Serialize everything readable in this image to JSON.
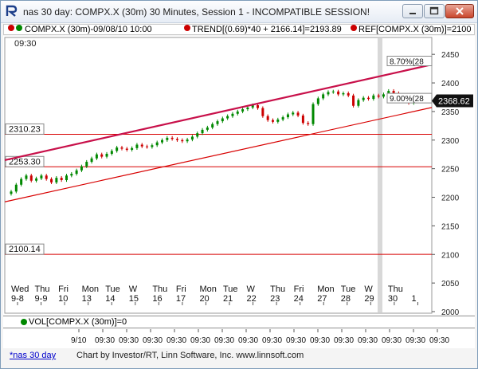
{
  "window": {
    "title": "nas 30 day: COMPX.X (30m) 30 Minutes, Session 1 - INCOMPATIBLE SESSION!",
    "app_icon": "investor-rt-icon"
  },
  "header": {
    "symbol": "COMPX.X (30m)-09/08/10 10:00",
    "trend": "TREND[(0.69)*40 + 2166.14]=2193.89",
    "ref": "REF[COMPX.X (30m)]=2100",
    "time": "09:30"
  },
  "colors": {
    "bull": "#008800",
    "bear": "#cc0000",
    "trend": "#c8104a",
    "line": "#d80000"
  },
  "chart_data": {
    "type": "candlestick",
    "ylim": [
      2000,
      2460
    ],
    "yticks": [
      "2450",
      "2400",
      "2350",
      "2300",
      "2250",
      "2200",
      "2150",
      "2100",
      "2050",
      "2000"
    ],
    "day_labels": [
      {
        "dow": "Wed",
        "date": "9-8"
      },
      {
        "dow": "Thu",
        "date": "9-9"
      },
      {
        "dow": "Fri",
        "date": "10"
      },
      {
        "dow": "Mon",
        "date": "13"
      },
      {
        "dow": "Tue",
        "date": "14"
      },
      {
        "dow": "W",
        "date": "15"
      },
      {
        "dow": "Thu",
        "date": "16"
      },
      {
        "dow": "Fri",
        "date": "17"
      },
      {
        "dow": "Mon",
        "date": "20"
      },
      {
        "dow": "Tue",
        "date": "21"
      },
      {
        "dow": "W",
        "date": "22"
      },
      {
        "dow": "Thu",
        "date": "23"
      },
      {
        "dow": "Fri",
        "date": "24"
      },
      {
        "dow": "Mon",
        "date": "27"
      },
      {
        "dow": "Tue",
        "date": "28"
      },
      {
        "dow": "W",
        "date": "29"
      },
      {
        "dow": "Thu",
        "date": "30"
      },
      {
        "dow": "",
        "date": "1"
      }
    ],
    "time_labels": [
      "9/10",
      "09:30",
      "09:30",
      "09:30",
      "09:30",
      "09:30",
      "09:30",
      "09:30",
      "09:30",
      "09:30",
      "09:30",
      "09:30",
      "09:30",
      "09:30",
      "09:30",
      "09:30",
      "09:30",
      "09:30"
    ],
    "levels": [
      {
        "label": "2310.23",
        "value": 2310.23
      },
      {
        "label": "2253.30",
        "value": 2253.3
      },
      {
        "label": "2100.14",
        "value": 2100.14
      }
    ],
    "channel_labels": {
      "upper": "8.70%(28",
      "lower": "9.00%(28"
    },
    "last_price": "2368.62",
    "closes": [
      2210,
      2222,
      2232,
      2238,
      2229,
      2233,
      2238,
      2232,
      2226,
      2234,
      2230,
      2238,
      2241,
      2247,
      2254,
      2262,
      2268,
      2275,
      2271,
      2276,
      2281,
      2287,
      2285,
      2283,
      2286,
      2292,
      2289,
      2288,
      2291,
      2296,
      2300,
      2304,
      2302,
      2300,
      2298,
      2301,
      2306,
      2312,
      2318,
      2322,
      2328,
      2333,
      2338,
      2342,
      2346,
      2350,
      2354,
      2357,
      2361,
      2356,
      2342,
      2335,
      2332,
      2336,
      2340,
      2345,
      2348,
      2343,
      2330,
      2328,
      2363,
      2373,
      2380,
      2384,
      2385,
      2380,
      2382,
      2378,
      2360,
      2370,
      2374,
      2372,
      2378,
      2376,
      2380,
      2386,
      2382,
      2376,
      2372,
      2365,
      2369,
      2368.62
    ]
  },
  "volume": {
    "label": "VOL[COMPX.X (30m)]=0"
  },
  "status": {
    "tab": "*nas 30 day",
    "text": "Chart by Investor/RT, Linn Software, Inc. www.linnsoft.com"
  }
}
